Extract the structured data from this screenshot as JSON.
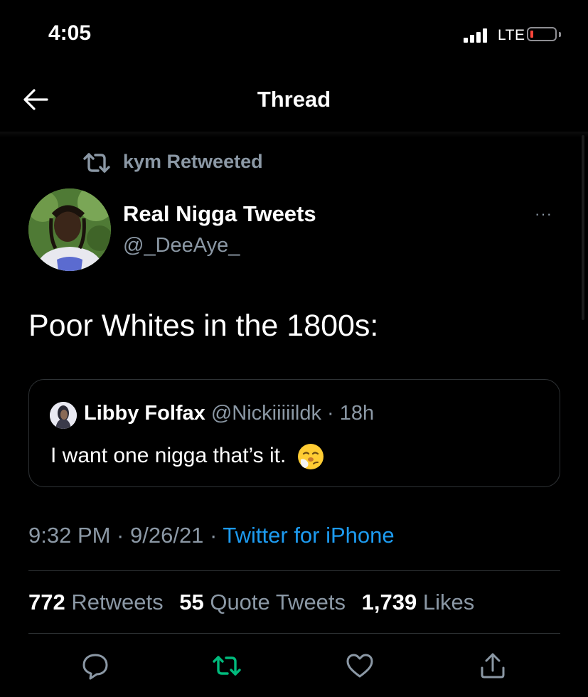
{
  "status_bar": {
    "time": "4:05",
    "network": "LTE"
  },
  "header": {
    "title": "Thread"
  },
  "retweet_context": {
    "text": "kym Retweeted"
  },
  "tweet": {
    "display_name": "Real Nigga Tweets",
    "handle": "@_DeeAye_",
    "more": "···",
    "text": "Poor Whites in the 1800s:",
    "timestamp": "9:32 PM · 9/26/21 · ",
    "source": "Twitter for iPhone"
  },
  "quoted_tweet": {
    "display_name": "Libby Folfax",
    "handle": " @Nickiiiiildk",
    "time": " · 18h",
    "text": "I want one nigga that’s it."
  },
  "stats": {
    "retweets_count": "772",
    "retweets_label": "Retweets",
    "quotes_count": "55",
    "quotes_label": "Quote Tweets",
    "likes_count": "1,739",
    "likes_label": "Likes"
  },
  "icons": {
    "reply": "reply-icon",
    "retweet": "retweet-icon",
    "like": "heart-icon",
    "share": "share-icon"
  },
  "colors": {
    "background": "#000000",
    "link": "#1d9bf0",
    "muted": "#8b98a5",
    "retweet_active": "#00ba7c"
  }
}
